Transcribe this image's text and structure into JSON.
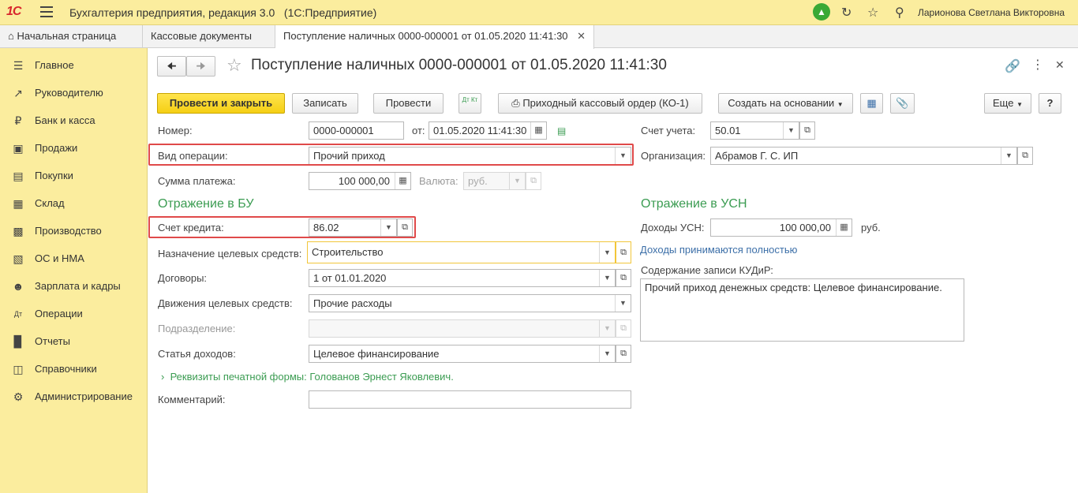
{
  "app": {
    "logo": "1С",
    "title": "Бухгалтерия предприятия, редакция 3.0",
    "platform": "(1С:Предприятие)",
    "user": "Ларионова Светлана Викторовна"
  },
  "tabs": [
    {
      "label": "Начальная страница"
    },
    {
      "label": "Кассовые документы"
    },
    {
      "label": "Поступление наличных 0000-000001 от 01.05.2020 11:41:30"
    }
  ],
  "sidebar": [
    {
      "label": "Главное",
      "icon": "menu-icon"
    },
    {
      "label": "Руководителю",
      "icon": "trend-icon"
    },
    {
      "label": "Банк и касса",
      "icon": "ruble-icon"
    },
    {
      "label": "Продажи",
      "icon": "bag-icon"
    },
    {
      "label": "Покупки",
      "icon": "cart-icon"
    },
    {
      "label": "Склад",
      "icon": "grid-icon"
    },
    {
      "label": "Производство",
      "icon": "factory-icon"
    },
    {
      "label": "ОС и НМА",
      "icon": "truck-icon"
    },
    {
      "label": "Зарплата и кадры",
      "icon": "person-icon"
    },
    {
      "label": "Операции",
      "icon": "dtkt-icon"
    },
    {
      "label": "Отчеты",
      "icon": "bar-chart-icon"
    },
    {
      "label": "Справочники",
      "icon": "book-icon"
    },
    {
      "label": "Администрирование",
      "icon": "gear-icon"
    }
  ],
  "document": {
    "title": "Поступление наличных 0000-000001 от 01.05.2020 11:41:30"
  },
  "toolbar": {
    "post_close": "Провести и закрыть",
    "save": "Записать",
    "post": "Провести",
    "dtkt": "Дт Кт",
    "print_order": "Приходный кассовый ордер (КО-1)",
    "create_based": "Создать на основании",
    "more": "Еще",
    "help": "?"
  },
  "form": {
    "number_label": "Номер:",
    "number_value": "0000-000001",
    "date_label": "от:",
    "date_value": "01.05.2020 11:41:30",
    "operation_label": "Вид операции:",
    "operation_value": "Прочий приход",
    "amount_label": "Сумма платежа:",
    "amount_value": "100 000,00",
    "currency_label": "Валюта:",
    "currency_value": "руб.",
    "account_label": "Счет учета:",
    "account_value": "50.01",
    "org_label": "Организация:",
    "org_value": "Абрамов Г. С. ИП"
  },
  "bu": {
    "heading": "Отражение в БУ",
    "credit_label": "Счет кредита:",
    "credit_value": "86.02",
    "purpose_label": "Назначение целевых средств:",
    "purpose_value": "Строительство",
    "contract_label": "Договоры:",
    "contract_value": "1 от 01.01.2020",
    "movement_label": "Движения целевых средств:",
    "movement_value": "Прочие расходы",
    "division_label": "Подразделение:",
    "division_value": "",
    "income_label": "Статья доходов:",
    "income_value": "Целевое финансирование",
    "print_details": "Реквизиты печатной формы: Голованов Эрнест Яковлевич.",
    "comment_label": "Комментарий:",
    "comment_value": ""
  },
  "usn": {
    "heading": "Отражение в УСН",
    "income_label": "Доходы УСН:",
    "income_value": "100 000,00",
    "currency": "руб.",
    "accepted_link": "Доходы принимаются полностью",
    "kudir_label": "Содержание записи КУДиР:",
    "kudir_value": "Прочий приход денежных средств: Целевое финансирование."
  }
}
